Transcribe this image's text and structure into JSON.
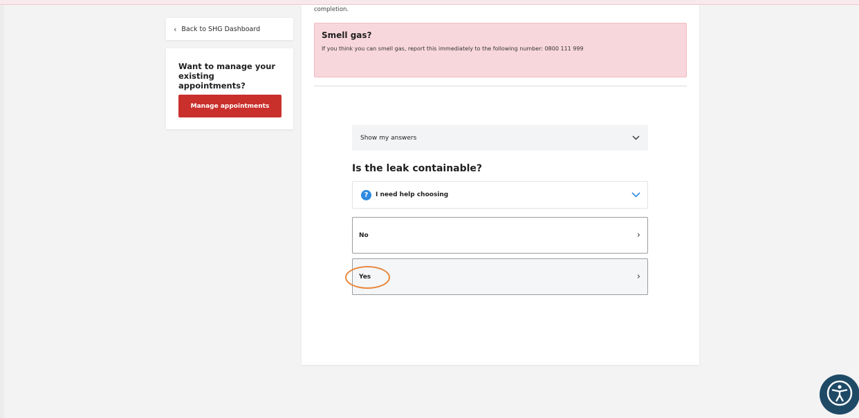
{
  "sidebar": {
    "back_label": "Back to SHG Dashboard",
    "back_icon": "chevron-left-icon",
    "manage_heading": "Want to manage your existing appointments?",
    "manage_button": "Manage appointments"
  },
  "main": {
    "completion_text": "completion.",
    "gas_alert": {
      "title": "Smell gas?",
      "message": "If you think you can smell gas, report this immediately to the following number: 0800 111 999"
    },
    "show_answers_label": "Show my answers",
    "question": "Is the leak containable?",
    "help": {
      "icon_glyph": "?",
      "icon": "question-circle-icon",
      "label": "I need help choosing"
    },
    "options": [
      {
        "label": "No"
      },
      {
        "label": "Yes"
      }
    ]
  },
  "colors": {
    "accent_red": "#c9302c",
    "alert_bg": "#f8d7dc",
    "help_blue": "#2f8ae0",
    "highlight_orange": "#e8863a",
    "a11y_button": "#1e4a66"
  }
}
